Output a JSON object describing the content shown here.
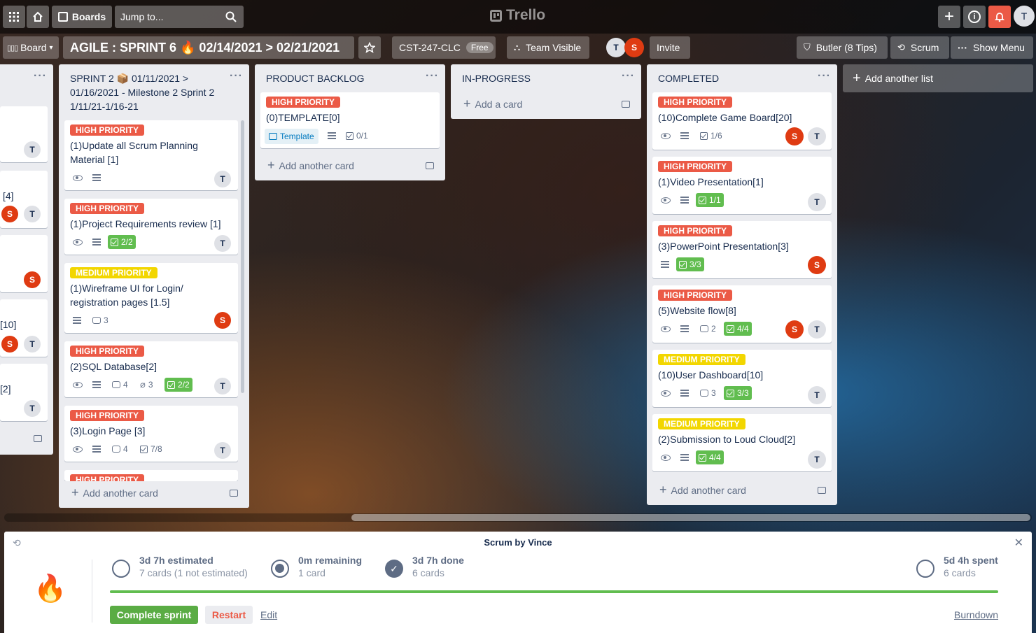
{
  "topnav": {
    "boards_label": "Boards",
    "jump_placeholder": "Jump to...",
    "logo_text": "Trello",
    "user_initial": "T"
  },
  "header": {
    "board_view": "Board",
    "board_title": "AGILE : SPRINT 6 🔥 02/14/2021 > 02/21/2021",
    "workspace": "CST-247-CLC",
    "plan": "Free",
    "visibility": "Team Visible",
    "invite": "Invite",
    "butler": "Butler (8 Tips)",
    "scrum": "Scrum",
    "show_menu": "Show Menu",
    "members": [
      "T",
      "S"
    ]
  },
  "partial_list": {
    "fragments": [
      "[4]",
      "[10]",
      "[2]"
    ]
  },
  "lists": {
    "sprint2": {
      "title_l1": "SPRINT 2 📦 01/11/2021 >",
      "title_l2": "01/16/2021 - Milestone 2 Sprint 2",
      "title_l3": "1/11/21-1/16-21",
      "add": "Add another card",
      "cards": [
        {
          "label": "HIGH PRIORITY",
          "title_l1": "(1)Update all Scrum Planning",
          "title_l2": "Material [1]"
        },
        {
          "label": "HIGH PRIORITY",
          "title_l1": "(1)Project Requirements review [1]",
          "checklist": "2/2"
        },
        {
          "label": "MEDIUM PRIORITY",
          "title_l1": "(1)Wireframe UI for Login/",
          "title_l2": "registration pages [1.5]",
          "comments": "3"
        },
        {
          "label": "HIGH PRIORITY",
          "title_l1": "(2)SQL Database[2]",
          "comments": "4",
          "attachments": "3",
          "checklist": "2/2"
        },
        {
          "label": "HIGH PRIORITY",
          "title_l1": "(3)Login Page [3]",
          "comments": "4",
          "checklist": "7/8"
        },
        {
          "label": "HIGH PRIORITY"
        }
      ]
    },
    "backlog": {
      "title": "PRODUCT BACKLOG",
      "add": "Add another card",
      "cards": [
        {
          "label": "HIGH PRIORITY",
          "title_l1": "(0)TEMPLATE[0]",
          "template": "Template",
          "checklist": "0/1"
        }
      ]
    },
    "inprogress": {
      "title": "IN-PROGRESS",
      "add": "Add a card"
    },
    "completed": {
      "title": "COMPLETED",
      "add": "Add another card",
      "cards": [
        {
          "label": "HIGH PRIORITY",
          "title_l1": "(10)Complete Game Board[20]",
          "checklist": "1/6"
        },
        {
          "label": "HIGH PRIORITY",
          "title_l1": "(1)Video Presentation[1]",
          "checklist": "1/1"
        },
        {
          "label": "HIGH PRIORITY",
          "title_l1": "(3)PowerPoint Presentation[3]",
          "checklist": "3/3"
        },
        {
          "label": "HIGH PRIORITY",
          "title_l1": "(5)Website flow[8]",
          "comments": "2",
          "checklist": "4/4"
        },
        {
          "label": "MEDIUM PRIORITY",
          "title_l1": "(10)User Dashboard[10]",
          "comments": "3",
          "checklist": "3/3"
        },
        {
          "label": "MEDIUM PRIORITY",
          "title_l1": "(2)Submission to Loud Cloud[2]",
          "checklist": "4/4"
        }
      ]
    },
    "add_list": "Add another list"
  },
  "scrum_panel": {
    "title": "Scrum by Vince",
    "estimated_main": "3d 7h estimated",
    "estimated_sub": "7 cards (1 not estimated)",
    "remaining_main": "0m remaining",
    "remaining_sub": "1 card",
    "done_main": "3d 7h done",
    "done_sub": "6 cards",
    "spent_main": "5d 4h spent",
    "spent_sub": "6 cards",
    "progress": 1.0,
    "complete_btn": "Complete sprint",
    "restart_btn": "Restart",
    "edit_link": "Edit",
    "burndown_link": "Burndown",
    "flame": "🔥"
  },
  "colors": {
    "high": "#eb5a46",
    "medium": "#f2d600",
    "green": "#61bd4f",
    "avatar_s": "#df3b12"
  }
}
